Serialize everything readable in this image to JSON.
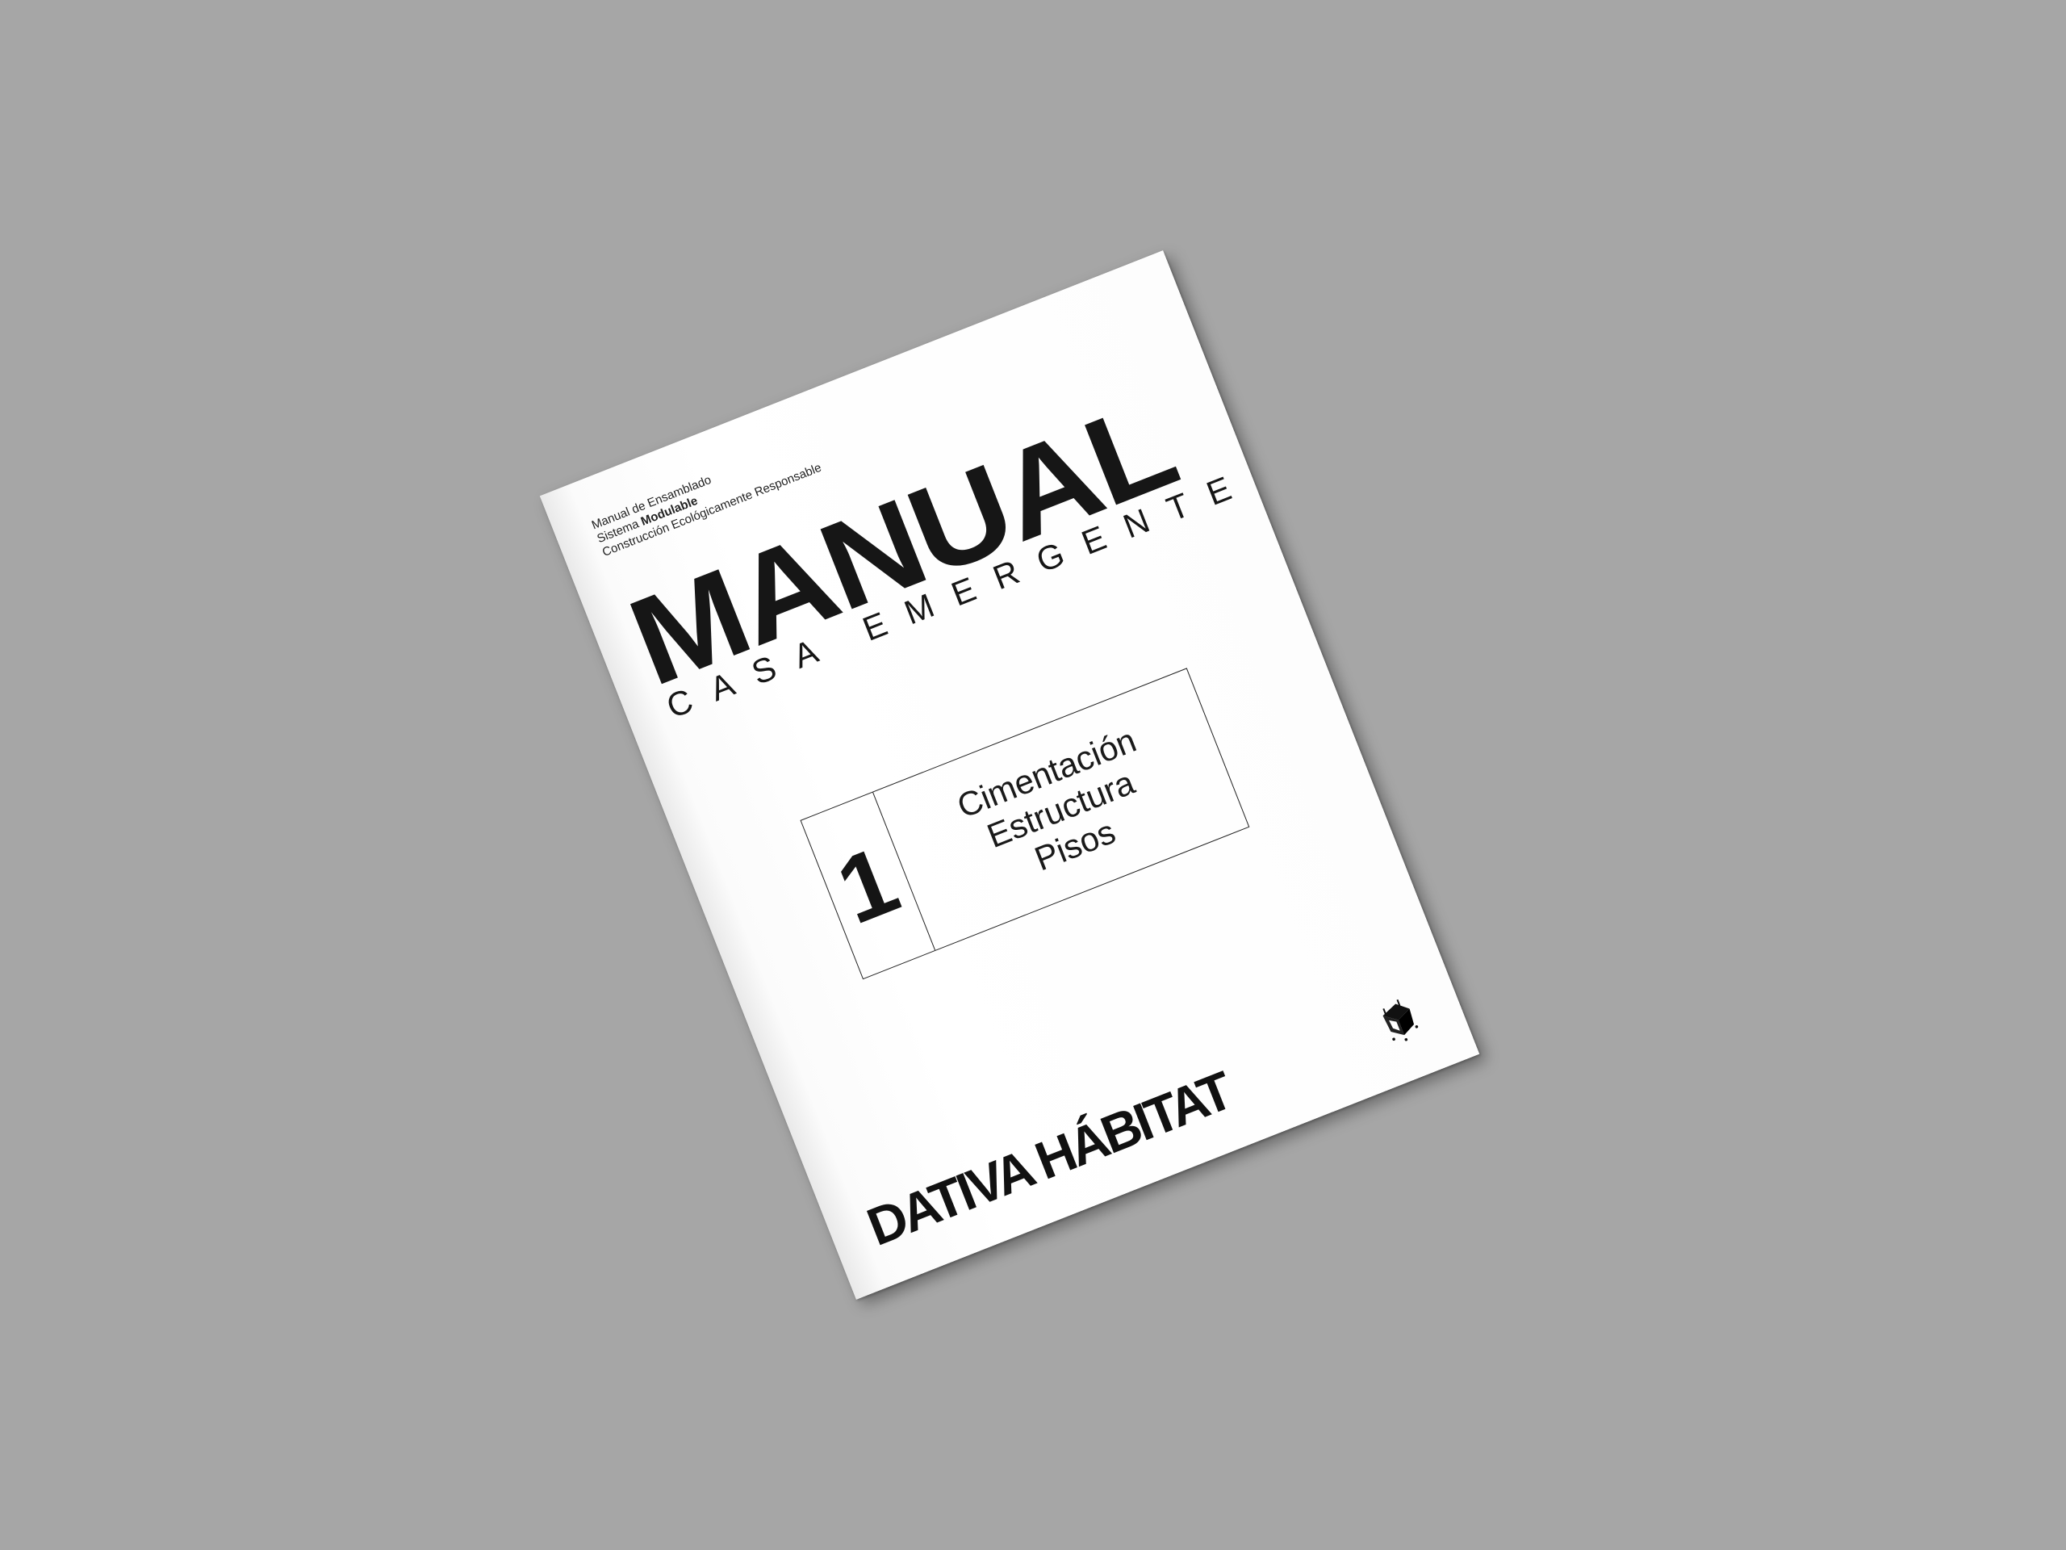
{
  "cover": {
    "meta": {
      "line1": "Manual de Ensamblado",
      "line2_prefix": "Sistema ",
      "line2_bold": "Modulable",
      "line3": "Construcción Ecológicamente Responsable"
    },
    "title": "MANUAL",
    "subtitle": "CASA EMERGENTE",
    "volume": {
      "number": "1",
      "topics": [
        "Cimentación",
        "Estructura",
        "Pisos"
      ]
    },
    "logo_icon": "house-module-logo-icon",
    "brand": "DATIVA HÁBITAT"
  },
  "colors": {
    "background": "#a6a6a6",
    "page": "#ffffff",
    "ink": "#161616"
  }
}
